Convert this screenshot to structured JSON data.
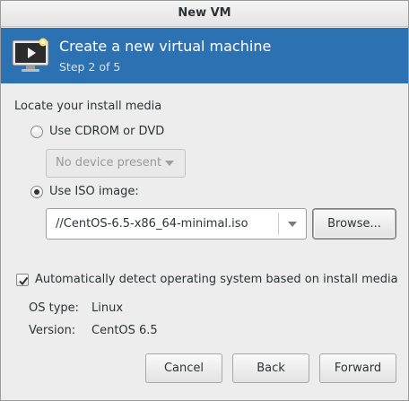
{
  "window": {
    "title": "New VM"
  },
  "header": {
    "title": "Create a new virtual machine",
    "step": "Step 2 of 5"
  },
  "install_media": {
    "section_label": "Locate your install media",
    "cdrom_label": "Use CDROM or DVD",
    "cdrom_selected": false,
    "device_dropdown_value": "No device present",
    "iso_label": "Use ISO image:",
    "iso_selected": true,
    "iso_path": "//CentOS-6.5-x86_64-minimal.iso",
    "browse_label": "Browse..."
  },
  "os_detect": {
    "checkbox_label": "Automatically detect operating system based on install media",
    "checked": true,
    "os_type_label": "OS type:",
    "os_type_value": "Linux",
    "version_label": "Version:",
    "version_value": "CentOS 6.5"
  },
  "footer": {
    "cancel_label": "Cancel",
    "back_label": "Back",
    "forward_label": "Forward"
  },
  "colors": {
    "header_bg": "#2c72b3",
    "window_bg": "#ededed"
  }
}
